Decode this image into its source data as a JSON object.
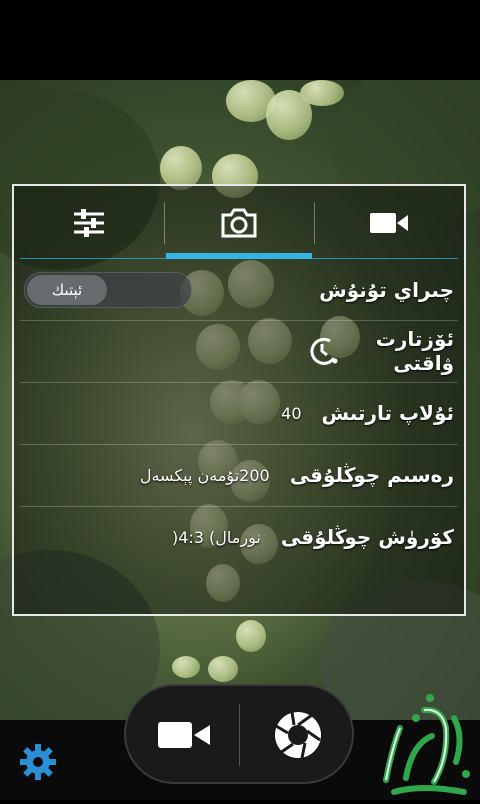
{
  "camera": {
    "tabs": [
      {
        "name": "settings-sliders",
        "icon": "sliders-icon",
        "active": false
      },
      {
        "name": "photo",
        "icon": "camera-icon",
        "active": true
      },
      {
        "name": "video",
        "icon": "video-camera-icon",
        "active": false
      }
    ],
    "settings": {
      "flash": {
        "label": "چىراي تۇنۇش",
        "toggle_label": "ئېتىك"
      },
      "timer": {
        "label": "ئۆزتارت ۋاقتى",
        "icon": "timer-icon"
      },
      "quality": {
        "label": "ئۇلاپ تارتىش",
        "value": "40"
      },
      "resolution": {
        "label": "رەسىم چوڭلۇقى",
        "value": "200تۇمەن پېكسەل"
      },
      "preview_size": {
        "label": "كۆرۈش چوڭلۇقى",
        "value": "نورمال) 4:3("
      }
    },
    "controls": {
      "video_icon": "video-camera-icon",
      "shutter_icon": "aperture-icon",
      "settings_icon": "gear-icon"
    },
    "accent_color": "#33b5e5",
    "watermark_color": "#2ea84a"
  }
}
